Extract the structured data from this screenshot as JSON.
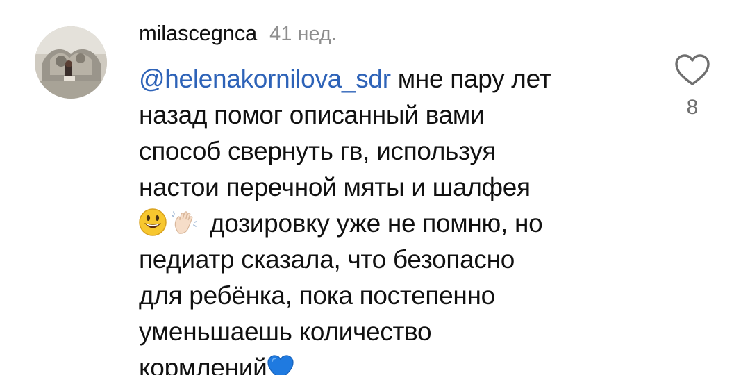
{
  "comment": {
    "username": "milascegnca",
    "time": "41 нед.",
    "mention": "@helenakornilova_sdr",
    "lines": [
      " мне пару лет",
      "назад помог описанный вами",
      "способ свернуть гв, используя",
      "настои перечной мяты и шалфея",
      " дозировку уже не помню, но",
      "педиатр сказала, что безопасно",
      "для ребёнка, пока постепенно",
      "уменьшаешь количество",
      "кормлений"
    ],
    "emojis": [
      "smiling-face-emoji",
      "waving-hand-emoji",
      "blue-heart-emoji"
    ],
    "like_count": "8"
  },
  "icons": {
    "like": "heart-outline-icon"
  },
  "colors": {
    "mention": "#2e63b8",
    "timestamp": "#8e8e8e",
    "text": "#111111",
    "heart_emoji": "#1f7ae0"
  }
}
